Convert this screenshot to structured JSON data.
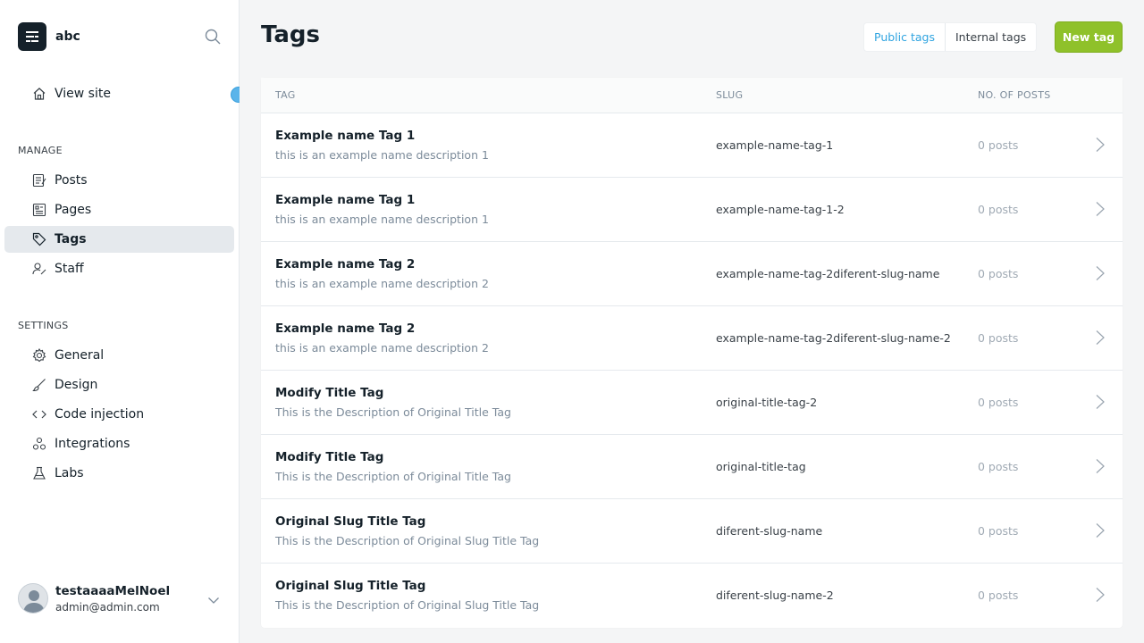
{
  "sidebar": {
    "site_name": "abc",
    "view_site": "View site",
    "manage_title": "MANAGE",
    "settings_title": "SETTINGS",
    "manage_items": [
      {
        "label": "Posts",
        "icon": "posts-icon"
      },
      {
        "label": "Pages",
        "icon": "pages-icon"
      },
      {
        "label": "Tags",
        "icon": "tag-icon",
        "active": true
      },
      {
        "label": "Staff",
        "icon": "staff-icon"
      }
    ],
    "settings_items": [
      {
        "label": "General",
        "icon": "gear-icon"
      },
      {
        "label": "Design",
        "icon": "brush-icon"
      },
      {
        "label": "Code injection",
        "icon": "code-icon"
      },
      {
        "label": "Integrations",
        "icon": "integrations-icon"
      },
      {
        "label": "Labs",
        "icon": "flask-icon"
      }
    ],
    "user": {
      "name": "testaaaaMelNoel",
      "email": "admin@admin.com"
    }
  },
  "header": {
    "title": "Tags",
    "public_tags": "Public tags",
    "internal_tags": "Internal tags",
    "new_tag": "New tag"
  },
  "table": {
    "columns": [
      "TAG",
      "SLUG",
      "NO. OF POSTS"
    ],
    "rows": [
      {
        "name": "Example name Tag 1",
        "description": "this is an example name description 1",
        "slug": "example-name-tag-1",
        "posts": "0 posts"
      },
      {
        "name": "Example name Tag 1",
        "description": "this is an example name description 1",
        "slug": "example-name-tag-1-2",
        "posts": "0 posts"
      },
      {
        "name": "Example name Tag 2",
        "description": "this is an example name description 2",
        "slug": "example-name-tag-2diferent-slug-name",
        "posts": "0 posts"
      },
      {
        "name": "Example name Tag 2",
        "description": "this is an example name description 2",
        "slug": "example-name-tag-2diferent-slug-name-2",
        "posts": "0 posts"
      },
      {
        "name": "Modify Title Tag",
        "description": "This is the Description of Original Title Tag",
        "slug": "original-title-tag-2",
        "posts": "0 posts"
      },
      {
        "name": "Modify Title Tag",
        "description": "This is the Description of Original Title Tag",
        "slug": "original-title-tag",
        "posts": "0 posts"
      },
      {
        "name": "Original Slug Title Tag",
        "description": "This is the Description of Original Slug Title Tag",
        "slug": "diferent-slug-name",
        "posts": "0 posts"
      },
      {
        "name": "Original Slug Title Tag",
        "description": "This is the Description of Original Slug Title Tag",
        "slug": "diferent-slug-name-2",
        "posts": "0 posts"
      }
    ]
  },
  "colors": {
    "accent_blue": "#30a4e0",
    "new_button_green": "#8fc12a",
    "update_dot": "#5ab4ea",
    "active_nav_bg": "#e5e9ed"
  }
}
